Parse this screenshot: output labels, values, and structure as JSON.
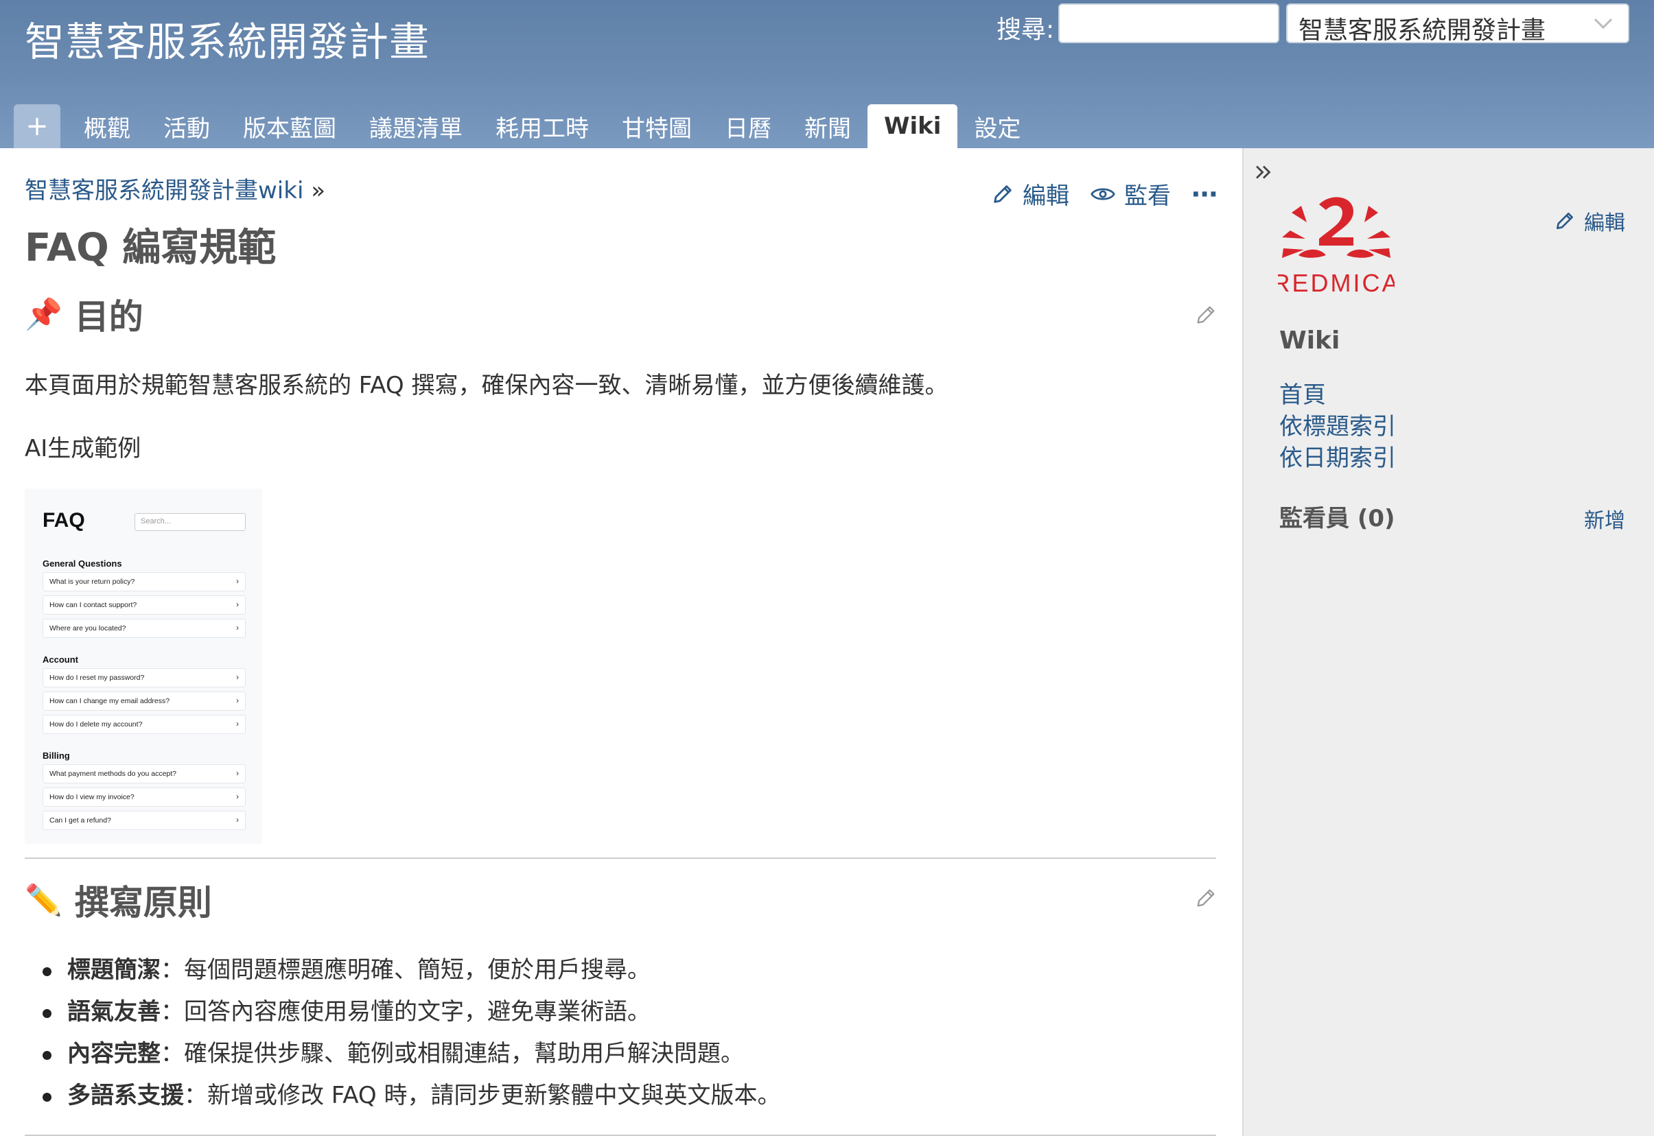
{
  "header": {
    "project_title": "智慧客服系統開發計畫",
    "search_label": "搜尋:",
    "search_value": "",
    "project_select_value": "智慧客服系統開發計畫"
  },
  "tabs": {
    "add": "+",
    "items": [
      "概觀",
      "活動",
      "版本藍圖",
      "議題清單",
      "耗用工時",
      "甘特圖",
      "日曆",
      "新聞",
      "Wiki",
      "設定"
    ],
    "selected": "Wiki"
  },
  "content": {
    "breadcrumb": "智慧客服系統開發計畫wiki",
    "breadcrumb_sep": "»",
    "actions": {
      "edit": "編輯",
      "watch": "監看",
      "more": "⋯"
    },
    "page_title": "FAQ 編寫規範",
    "section1": {
      "icon": "pushpin-icon",
      "emoji": "📌",
      "title": "目的",
      "paragraph": "本頁面用於規範智慧客服系統的 FAQ 撰寫，確保內容一致、清晰易懂，並方便後續維護。",
      "example_label": "AI生成範例"
    },
    "faq_image": {
      "title": "FAQ",
      "search_placeholder": "Search...",
      "categories": [
        {
          "name": "General Questions",
          "questions": [
            "What is your return policy?",
            "How can I contact support?",
            "Where are you located?"
          ]
        },
        {
          "name": "Account",
          "questions": [
            "How do I reset my password?",
            "How can I change my email address?",
            "How do I delete my account?"
          ]
        },
        {
          "name": "Billing",
          "questions": [
            "What payment methods do you accept?",
            "How do I view my invoice?",
            "Can I get a refund?"
          ]
        }
      ]
    },
    "section2": {
      "icon": "pencil-icon",
      "emoji": "✏️",
      "title": "撰寫原則",
      "items": [
        {
          "term": "標題簡潔",
          "desc": "：每個問題標題應明確、簡短，便於用戶搜尋。"
        },
        {
          "term": "語氣友善",
          "desc": "：回答內容應使用易懂的文字，避免專業術語。"
        },
        {
          "term": "內容完整",
          "desc": "：確保提供步驟、範例或相關連結，幫助用戶解決問題。"
        },
        {
          "term": "多語系支援",
          "desc": "：新增或修改 FAQ 時，請同步更新繁體中文與英文版本。"
        }
      ]
    }
  },
  "sidebar": {
    "toggle": "»",
    "edit": "編輯",
    "logo_text": "REDMICA",
    "wiki_title": "Wiki",
    "links": [
      "首頁",
      "依標題索引",
      "依日期索引"
    ],
    "watchers_title": "監看員 (0)",
    "watchers_add": "新增"
  },
  "colors": {
    "header_top": "#5f80a8",
    "header_bottom": "#7b9ac0",
    "link": "#2a5a8a",
    "logo_red": "#d8262c",
    "sidebar_bg": "#eeeeee"
  }
}
